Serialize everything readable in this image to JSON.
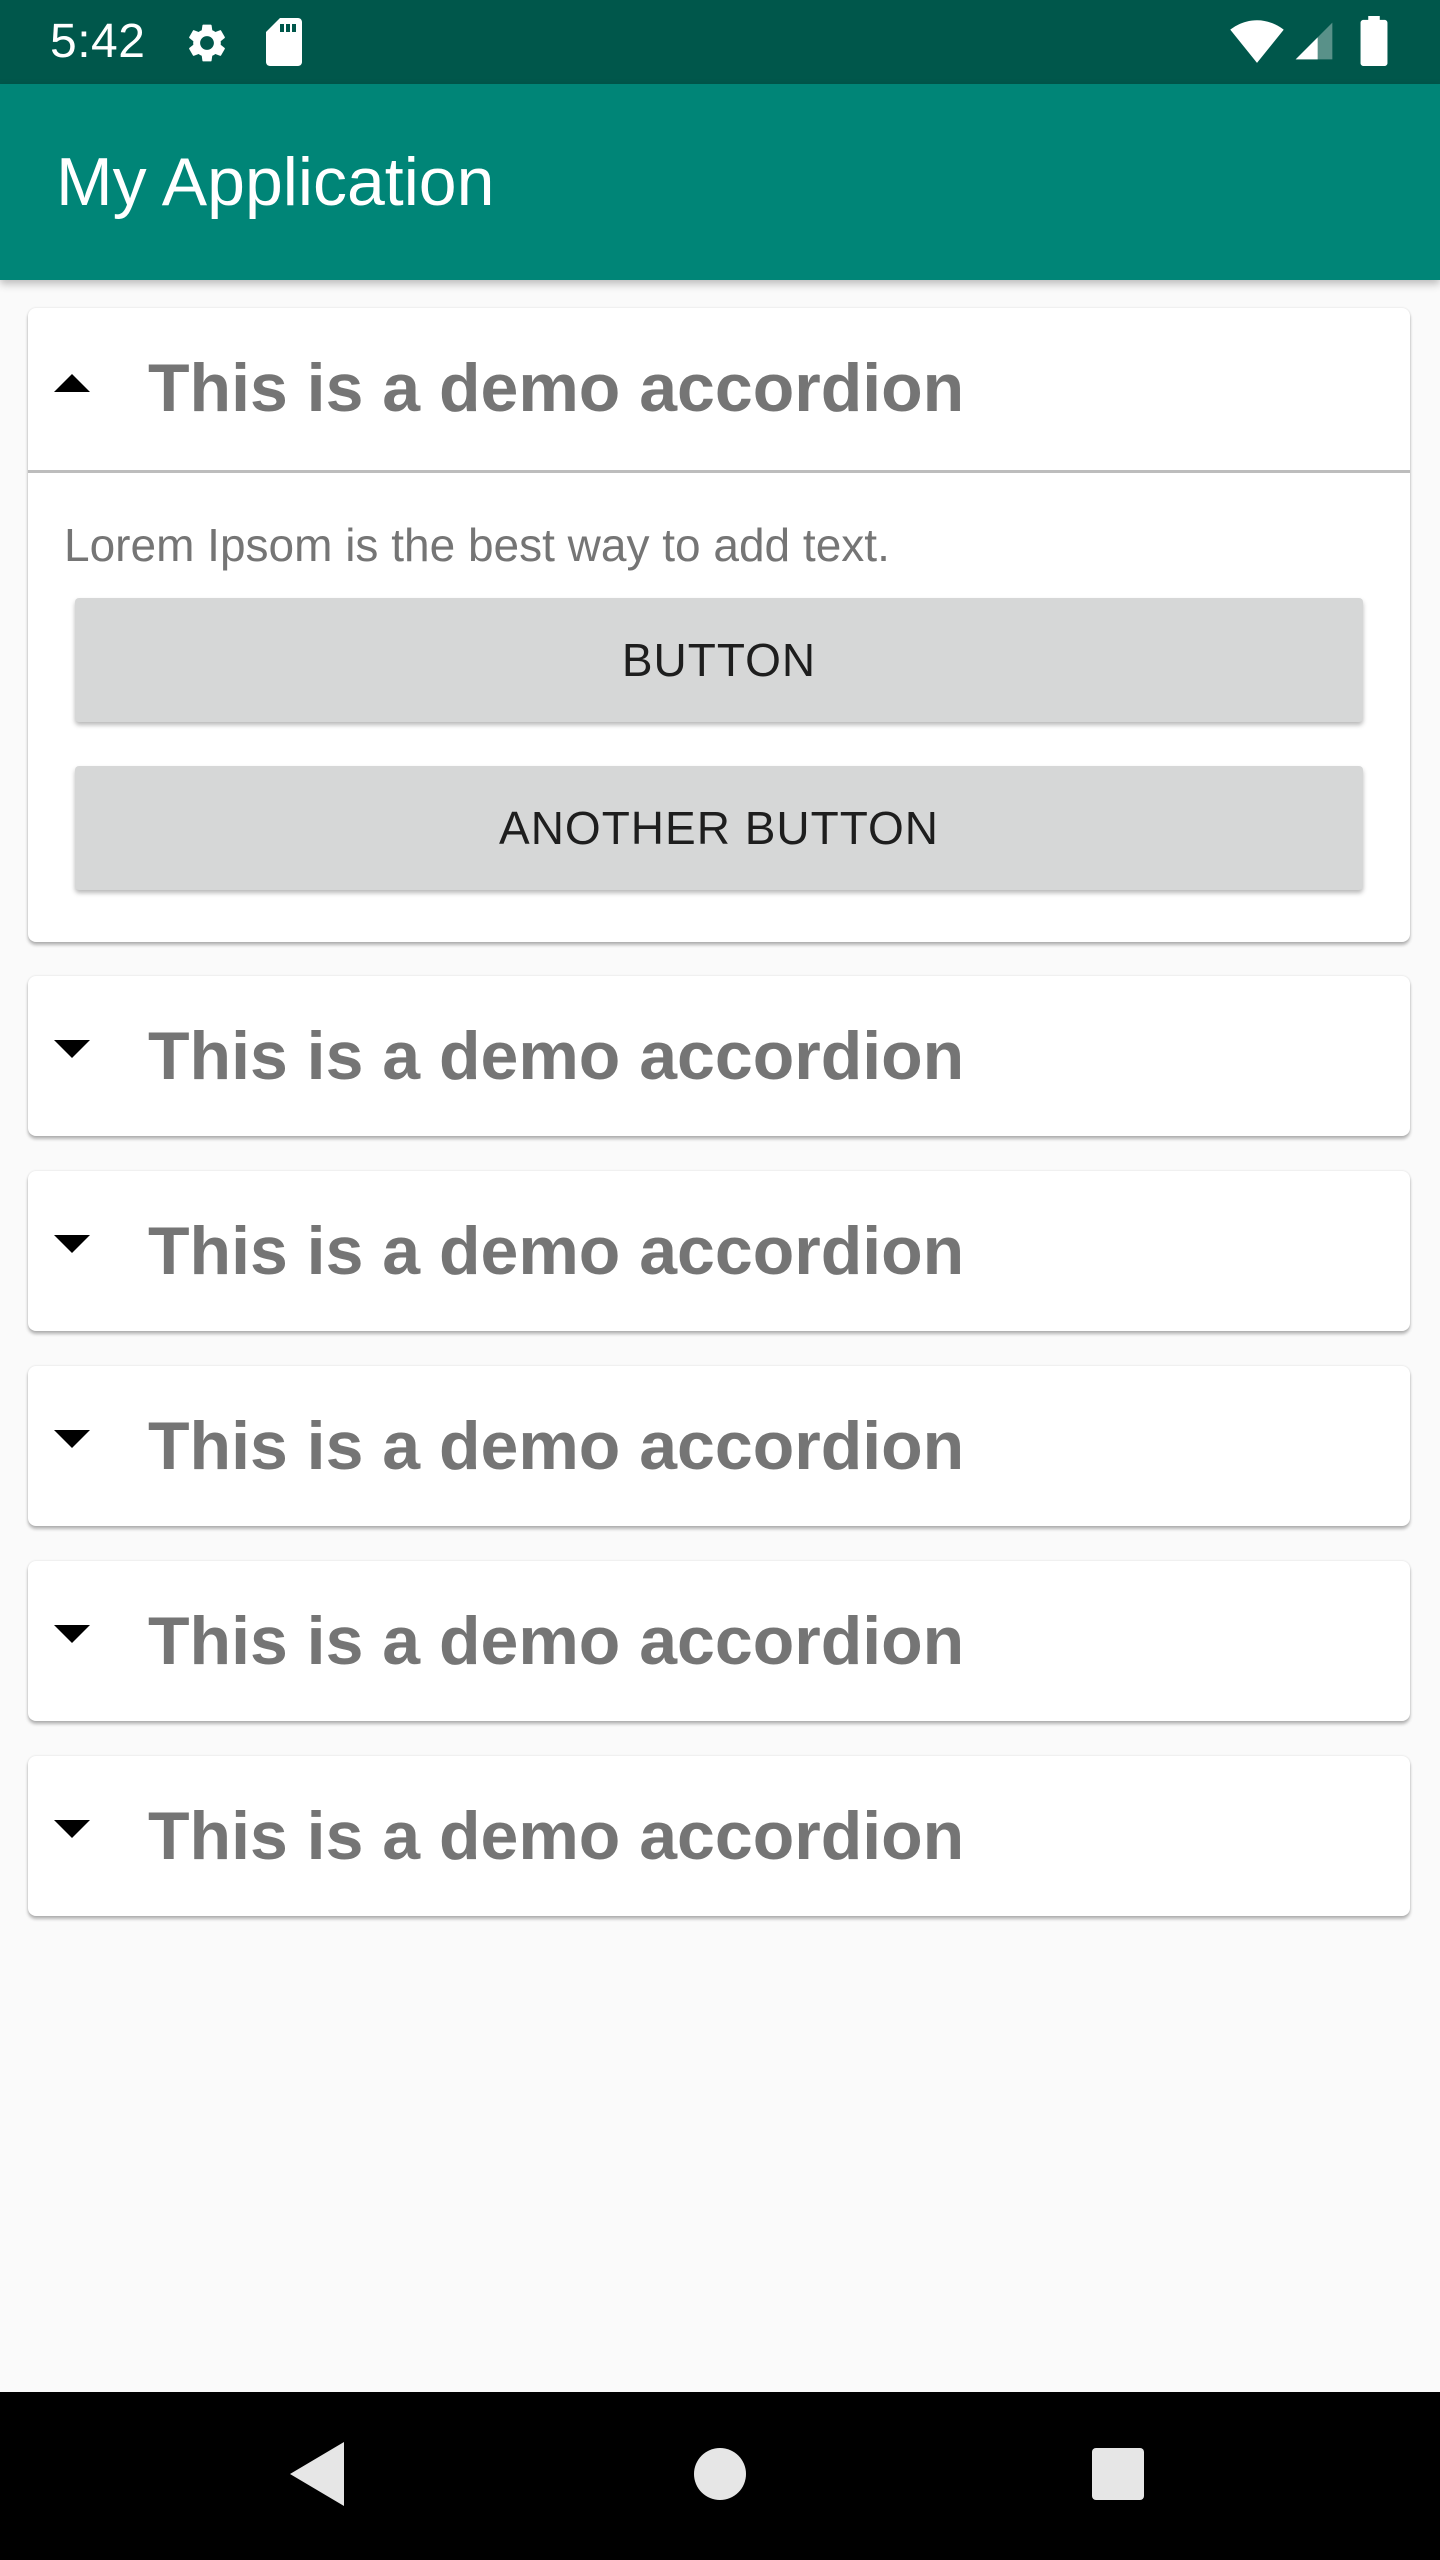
{
  "status_bar": {
    "time": "5:42",
    "icons": [
      "gear-icon",
      "sd-card-icon",
      "wifi-icon",
      "cell-signal-icon",
      "battery-icon"
    ]
  },
  "app_bar": {
    "title": "My Application"
  },
  "accordion": {
    "items": [
      {
        "title": "This is a demo accordion",
        "expanded": true,
        "body_text": "Lorem Ipsom is the best way to add text.",
        "button_label": "BUTTON",
        "another_button_label": "ANOTHER BUTTON"
      },
      {
        "title": "This is a demo accordion",
        "expanded": false
      },
      {
        "title": "This is a demo accordion",
        "expanded": false
      },
      {
        "title": "This is a demo accordion",
        "expanded": false
      },
      {
        "title": "This is a demo accordion",
        "expanded": false
      },
      {
        "title": "This is a demo accordion",
        "expanded": false
      }
    ]
  },
  "nav_bar": {
    "icons": [
      "back-icon",
      "home-icon",
      "recents-icon"
    ]
  },
  "colors": {
    "status_bar": "#00574b",
    "app_bar": "#008577",
    "background": "#fafafa",
    "card": "#ffffff",
    "title_text": "#757575",
    "button_bg": "#d6d7d7",
    "nav_bar": "#000000"
  }
}
